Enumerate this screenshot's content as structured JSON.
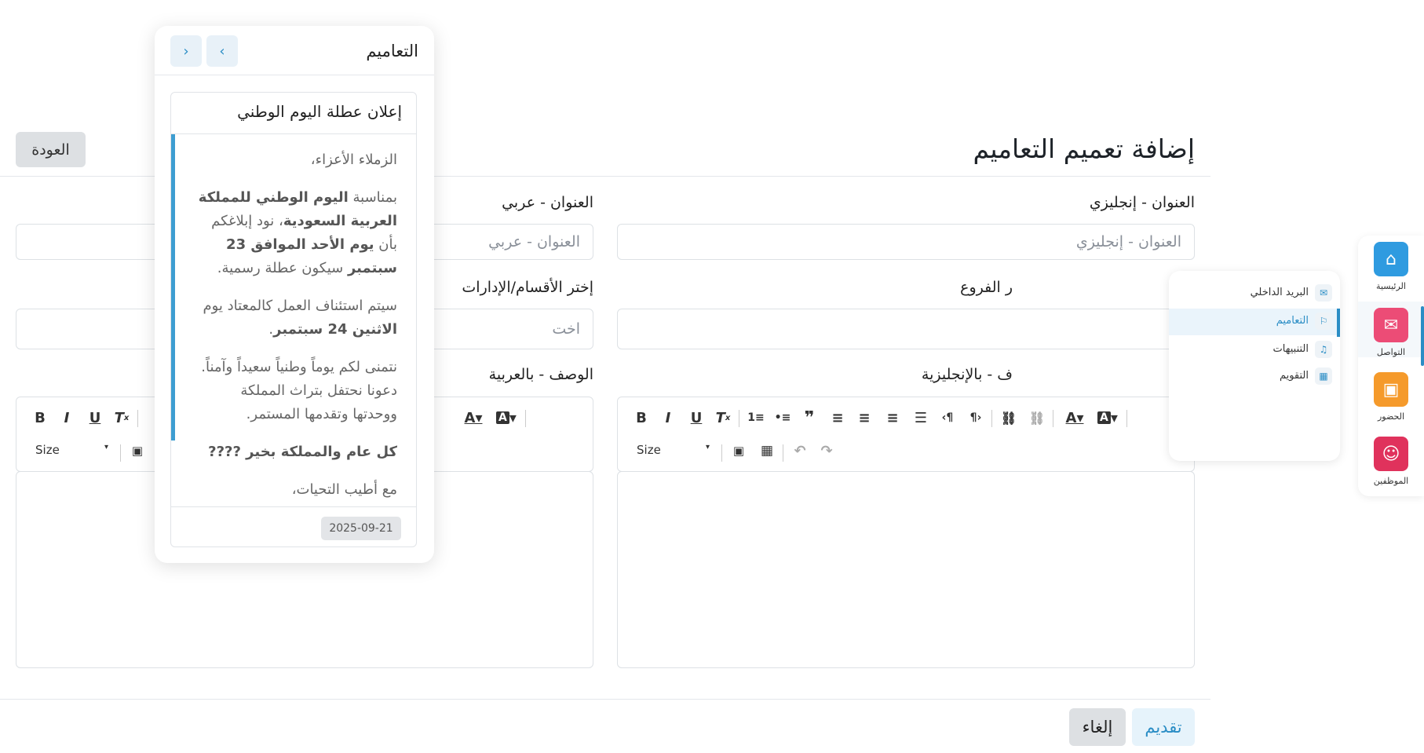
{
  "page": {
    "title": "إضافة تعميم التعاميم",
    "back_label": "العودة"
  },
  "form": {
    "title_en_label": "العنوان - إنجليزي",
    "title_en_placeholder": "العنوان - إنجليزي",
    "title_ar_label": "العنوان - عربي",
    "title_ar_placeholder": "العنوان - عربي",
    "branches_label": "ر الفروع",
    "departments_label": "إختر الأقسام/الإدارات",
    "departments_placeholder": "اخت",
    "desc_en_label": "ف - بالإنجليزية",
    "desc_ar_label": "الوصف - بالعربية",
    "size_label": "Size",
    "submit_label": "تقديم",
    "cancel_label": "إلغاء"
  },
  "popup": {
    "title": "التعاميم",
    "announcement": {
      "title": "إعلان عطلة اليوم الوطني",
      "greeting": "الزملاء الأعزاء،",
      "p1_a": "بمناسبة ",
      "p1_b": "اليوم الوطني للمملكة العربية السعودية",
      "p1_c": "، نود إبلاغكم بأن ",
      "p1_d": "يوم الأحد الموافق 23 سبتمبر",
      "p1_e": " سيكون عطلة رسمية.",
      "p2_a": "سيتم استئناف العمل كالمعتاد يوم ",
      "p2_b": "الاثنين 24 سبتمبر",
      "p2_c": ".",
      "p3": "نتمنى لكم يوماً وطنياً سعيداً وآمناً. دعونا نحتفل بتراث المملكة ووحدتها وتقدمها المستمر.",
      "p4": "كل عام والمملكة بخير ????",
      "p5": "مع أطيب التحيات،",
      "date": "2025-09-21"
    }
  },
  "rail": {
    "items": [
      {
        "label": "الرئيسية",
        "icon": "home-icon",
        "color": "#2f9be0"
      },
      {
        "label": "التواصل",
        "icon": "chat-icon",
        "color": "#ec4c76"
      },
      {
        "label": "الحضور",
        "icon": "attendance-icon",
        "color": "#f59a2b"
      },
      {
        "label": "الموظفين",
        "icon": "employees-icon",
        "color": "#e0325c"
      }
    ]
  },
  "submenu": {
    "items": [
      {
        "label": "البريد الداخلي",
        "icon": "mail-icon"
      },
      {
        "label": "التعاميم",
        "icon": "circulars-icon"
      },
      {
        "label": "التنبيهات",
        "icon": "bell-icon"
      },
      {
        "label": "التقويم",
        "icon": "calendar-icon"
      }
    ]
  }
}
